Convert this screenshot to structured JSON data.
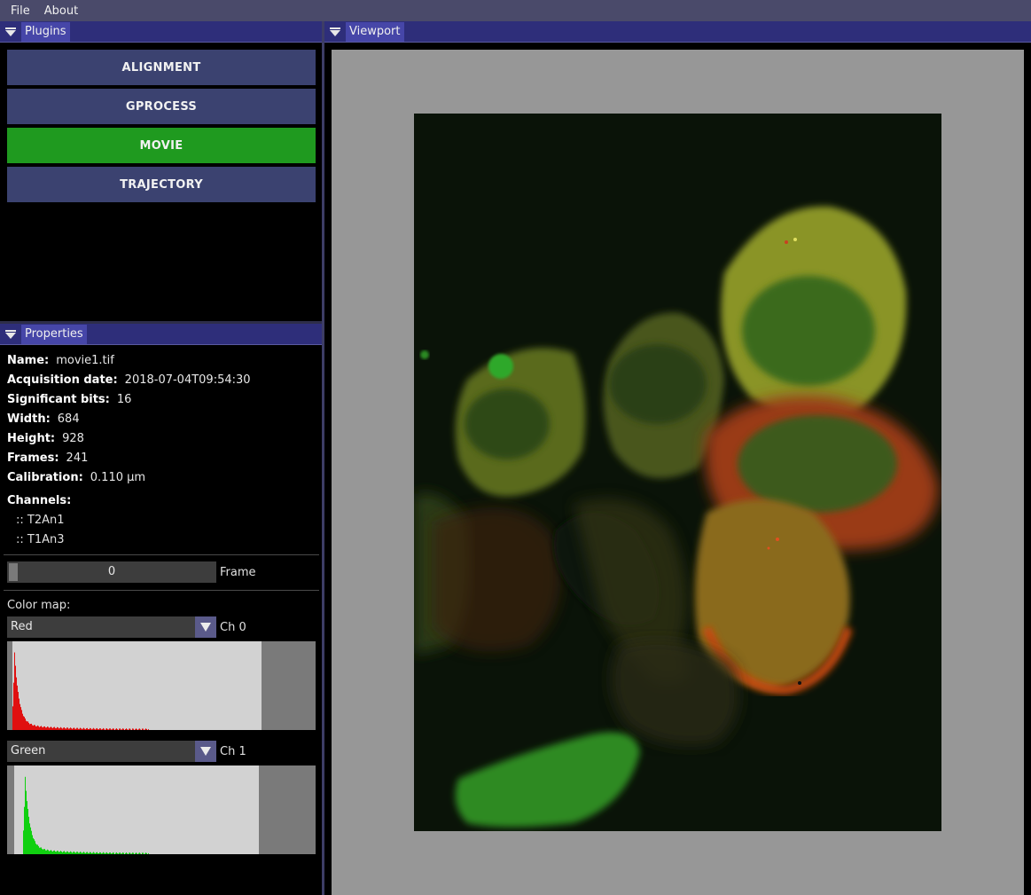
{
  "menu": {
    "file": "File",
    "about": "About"
  },
  "plugins_panel": {
    "title": "Plugins"
  },
  "plugins": [
    {
      "label": "ALIGNMENT",
      "active": false
    },
    {
      "label": "GPROCESS",
      "active": false
    },
    {
      "label": "MOVIE",
      "active": true
    },
    {
      "label": "TRAJECTORY",
      "active": false
    }
  ],
  "properties_panel": {
    "title": "Properties",
    "name_label": "Name:",
    "name": "movie1.tif",
    "acq_label": "Acquisition date:",
    "acq": "2018-07-04T09:54:30",
    "bits_label": "Significant bits:",
    "bits": "16",
    "width_label": "Width:",
    "width": "684",
    "height_label": "Height:",
    "height": "928",
    "frames_label": "Frames:",
    "frames": "241",
    "calib_label": "Calibration:",
    "calib": "0.110 µm",
    "channels_label": "Channels:",
    "channels": [
      ":: T2An1",
      ":: T1An3"
    ]
  },
  "frame_control": {
    "value": "0",
    "label": "Frame",
    "fraction": 0
  },
  "colormap": {
    "label": "Color map:",
    "channels": [
      {
        "selected": "Red",
        "channel_label": "Ch 0",
        "color": "#e01010"
      },
      {
        "selected": "Green",
        "channel_label": "Ch 1",
        "color": "#10d010"
      }
    ]
  },
  "viewport_panel": {
    "title": "Viewport"
  },
  "colors": {
    "menubar": "#4a4a6a",
    "panel_header": "#2e2e7a",
    "button": "#3b4270",
    "button_active": "#1f9a1f",
    "viewport_bg": "#979797"
  },
  "icons": {
    "collapse": "triangle-down-icon",
    "dropdown": "triangle-down-icon"
  }
}
